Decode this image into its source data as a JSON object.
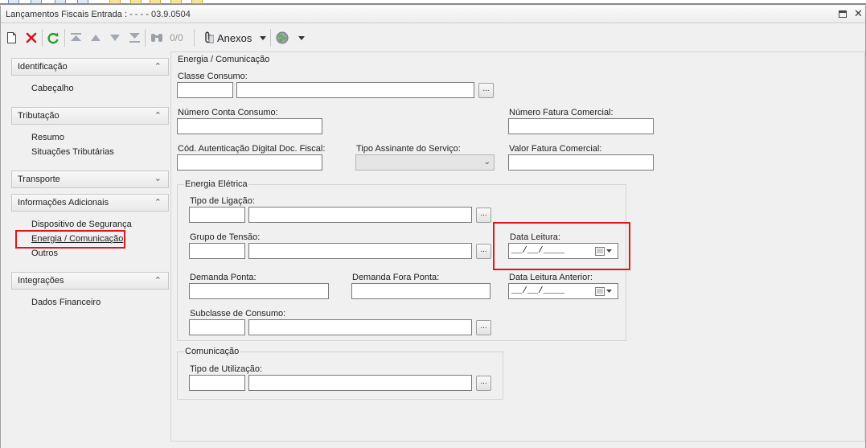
{
  "window": {
    "title": "Lançamentos Fiscais Entrada : - - - - 03.9.0504"
  },
  "toolbar": {
    "page_count": "0/0",
    "anexos_label": "Anexos"
  },
  "icons": [
    "new-icon",
    "delete-icon",
    "refresh-icon",
    "first-icon",
    "prev-icon",
    "next-icon",
    "last-icon",
    "search-icon",
    "attachment-icon",
    "dropdown-icon",
    "globe-icon",
    "restore-icon",
    "close-icon",
    "calendar-icon"
  ],
  "colors": {
    "highlight": "#e0161c",
    "delete": "#d4161c",
    "refresh": "#2e9a2e"
  },
  "sidebar": {
    "groups": [
      {
        "title": "Identificação",
        "items": [
          "Cabeçalho"
        ]
      },
      {
        "title": "Tributação",
        "items": [
          "Resumo",
          "Situações Tributárias"
        ]
      },
      {
        "title": "Transporte",
        "items": []
      },
      {
        "title": "Informações Adicionais",
        "items": [
          "Dispositivo de Segurança",
          "Energia / Comunicação",
          "Outros"
        ]
      },
      {
        "title": "Integrações",
        "items": [
          "Dados Financeiro"
        ]
      }
    ]
  },
  "form": {
    "section_title": "Energia / Comunicação",
    "classe_consumo": "Classe Consumo:",
    "numero_conta": "Número Conta Consumo:",
    "numero_fatura": "Número Fatura Comercial:",
    "cod_autenticacao": "Cód. Autenticação Digital Doc. Fiscal:",
    "tipo_assinante": "Tipo Assinante do Serviço:",
    "valor_fatura": "Valor Fatura Comercial:",
    "energia": {
      "title": "Energia Elétrica",
      "tipo_ligacao": "Tipo de Ligação:",
      "grupo_tensao": "Grupo de Tensão:",
      "data_leitura": "Data Leitura:",
      "demanda_ponta": "Demanda Ponta:",
      "demanda_fora": "Demanda Fora Ponta:",
      "data_leitura_anterior": "Data Leitura Anterior:",
      "subclasse": "Subclasse de Consumo:",
      "date_mask": "__/__/____"
    },
    "comunicacao": {
      "title": "Comunicação",
      "tipo_utilizacao": "Tipo de Utilização:"
    },
    "lookup_button": "..."
  }
}
